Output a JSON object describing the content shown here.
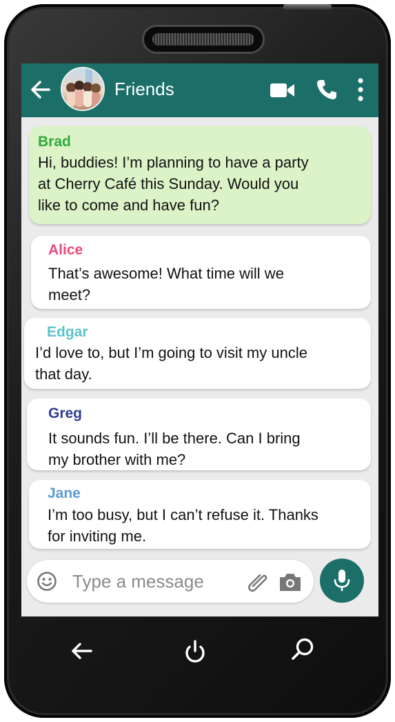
{
  "header": {
    "title": "Friends",
    "back_icon": "arrow-left-icon",
    "video_icon": "video-camera-icon",
    "call_icon": "phone-icon",
    "menu_icon": "more-vertical-icon",
    "bg_color": "#1c6f69"
  },
  "messages": [
    {
      "sender": "Brad",
      "sender_color": "#2eaa3a",
      "lines": [
        "Hi, buddies! I’m planning to have a party",
        "at Cherry Café this Sunday. Would you",
        "like to come and have fun?"
      ]
    },
    {
      "sender": "Alice",
      "sender_color": "#ea4a7b",
      "lines": [
        "That’s awesome! What time will we",
        "meet?"
      ]
    },
    {
      "sender": "Edgar",
      "sender_color": "#5ec3cb",
      "lines": [
        "I’d love to, but I’m going to visit my uncle",
        "that day."
      ]
    },
    {
      "sender": "Greg",
      "sender_color": "#2e3d8f",
      "lines": [
        "It sounds fun. I’ll be there. Can I bring",
        "my brother with me?"
      ]
    },
    {
      "sender": "Jane",
      "sender_color": "#5b9bd5",
      "lines": [
        "I’m too busy, but I can’t refuse it. Thanks",
        "for inviting me."
      ]
    }
  ],
  "composer": {
    "placeholder": "Type a message",
    "emoji_icon": "emoji-icon",
    "attach_icon": "paperclip-icon",
    "camera_icon": "camera-icon",
    "mic_icon": "microphone-icon"
  },
  "nav": {
    "back_icon": "arrow-left-icon",
    "home_icon": "power-icon",
    "search_icon": "search-icon"
  }
}
